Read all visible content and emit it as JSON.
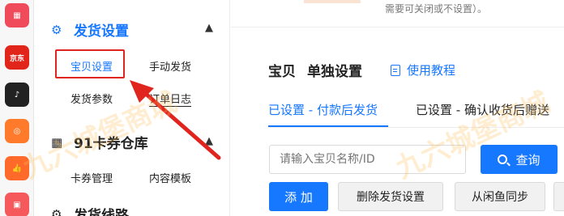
{
  "rail": {
    "icons": [
      {
        "name": "app-heart-grid-icon",
        "glyph": "▦"
      },
      {
        "name": "jd-icon",
        "glyph": "京东"
      },
      {
        "name": "douyin-icon",
        "glyph": "♪"
      },
      {
        "name": "kuaishou-icon",
        "glyph": "◎"
      },
      {
        "name": "thumbs-up-icon",
        "glyph": "👍"
      },
      {
        "name": "shopping-bag-icon",
        "glyph": "▣"
      }
    ]
  },
  "sidebar": {
    "group1": {
      "icon": "⚙",
      "title": "发货设置",
      "caret": "▲"
    },
    "group1_items": [
      "宝贝设置",
      "手动发货",
      "发货参数",
      "订单日志"
    ],
    "group2": {
      "icon": "▦",
      "title": "91卡券仓库",
      "caret": "▲"
    },
    "group2_items": [
      "卡券管理",
      "内容模板"
    ],
    "group3": {
      "icon": "⚙",
      "title": "发货线路"
    }
  },
  "main": {
    "top_note": "需要可关闭或不设置）。",
    "title_a": "宝贝",
    "title_b": "单独设置",
    "tutorial_label": "使用教程",
    "tabs": [
      "已设置 - 付款后发货",
      "已设置 - 确认收货后赠送"
    ],
    "search": {
      "placeholder": "请输入宝贝名称/ID",
      "button": "查询"
    },
    "buttons": {
      "add": "添 加",
      "delete": "删除发货设置",
      "sync": "从闲鱼同步"
    }
  },
  "watermark": [
    "九六城堡商城",
    "九六城堡商城"
  ],
  "colors": {
    "accent": "#1677ff",
    "annotation": "#e0251e"
  }
}
